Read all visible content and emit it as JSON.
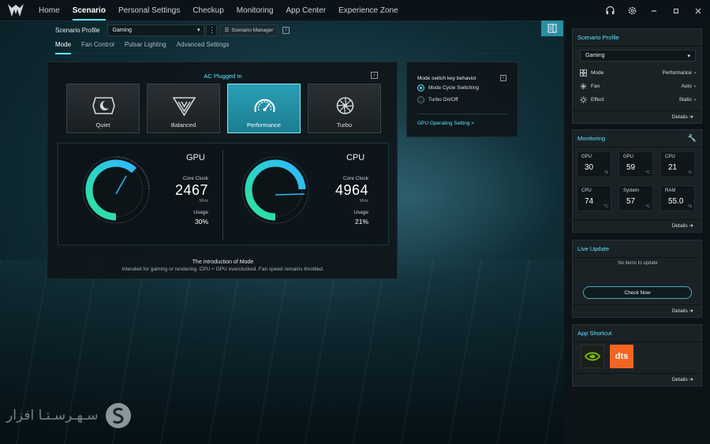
{
  "nav": {
    "items": [
      {
        "label": "Home"
      },
      {
        "label": "Scenario"
      },
      {
        "label": "Personal Settings"
      },
      {
        "label": "Checkup"
      },
      {
        "label": "Monitoring"
      },
      {
        "label": "App Center"
      },
      {
        "label": "Experience Zone"
      }
    ],
    "active_index": 1
  },
  "window_controls": [
    "headset-icon",
    "gear-icon",
    "minimize-icon",
    "maximize-icon",
    "close-icon"
  ],
  "profile": {
    "label": "Scenario Profile",
    "selected": "Gaming",
    "manager_label": "Scenario Manager"
  },
  "subtabs": [
    {
      "label": "Mode"
    },
    {
      "label": "Fan Control"
    },
    {
      "label": "Pulsar Lighting"
    },
    {
      "label": "Advanced Settings"
    }
  ],
  "mode_panel": {
    "ac_status": "AC Plugged In",
    "modes": [
      {
        "label": "Quiet",
        "icon": "quiet-mode-icon"
      },
      {
        "label": "Balanced",
        "icon": "balanced-mode-icon"
      },
      {
        "label": "Performance",
        "icon": "performance-mode-icon"
      },
      {
        "label": "Turbo",
        "icon": "turbo-mode-icon"
      }
    ],
    "active_mode": "Performance",
    "gpu": {
      "title": "GPU",
      "clock_label": "Core Clock",
      "clock": "2467",
      "unit": "MHz",
      "usage_label": "Usage",
      "usage": "30%",
      "usage_value": 30
    },
    "cpu": {
      "title": "CPU",
      "clock_label": "Core Clock",
      "clock": "4964",
      "unit": "MHz",
      "usage_label": "Usage",
      "usage": "21%",
      "usage_value": 21
    },
    "intro_title": "The introduction of Mode",
    "intro_text": "Intended for gaming or rendering. CPU + GPU overclocked. Fan speed remains throttled."
  },
  "switch_panel": {
    "title": "Mode switch key behavior",
    "options": [
      {
        "label": "Mode Cycle Switching",
        "selected": true
      },
      {
        "label": "Turbo On/Off",
        "selected": false
      }
    ],
    "link": "GPU Operating Setting >"
  },
  "right": {
    "scenario": {
      "title": "Scenario Profile",
      "selected": "Gaming",
      "rows": [
        {
          "label": "Mode",
          "value": "Performance",
          "icon": "mode-icon"
        },
        {
          "label": "Fan",
          "value": "Auto",
          "icon": "fan-icon"
        },
        {
          "label": "Effect",
          "value": "Static",
          "icon": "effect-icon"
        }
      ],
      "details": "Details"
    },
    "monitoring": {
      "title": "Monitoring",
      "tiles": [
        {
          "label": "GPU",
          "value": "30",
          "unit": "%"
        },
        {
          "label": "GPU",
          "value": "59",
          "unit": "°C"
        },
        {
          "label": "CPU",
          "value": "21",
          "unit": "%"
        },
        {
          "label": "CPU",
          "value": "74",
          "unit": "°C"
        },
        {
          "label": "System",
          "value": "57",
          "unit": "°C"
        },
        {
          "label": "RAM",
          "value": "55.0",
          "unit": "%"
        }
      ],
      "details": "Details"
    },
    "live_update": {
      "title": "Live Update",
      "empty": "No items to update",
      "button": "Check Now",
      "details": "Details"
    },
    "app_shortcut": {
      "title": "App Shortcut",
      "apps": [
        {
          "name": "nvidia-icon",
          "color": "#76b900"
        },
        {
          "name": "dts-icon",
          "label": "dts",
          "color": "#f26522"
        }
      ],
      "details": "Details"
    }
  },
  "colors": {
    "accent": "#5fe3ff",
    "panel": "#1a2226"
  },
  "watermark": {
    "text": "سـهـرسـتـا افزار"
  }
}
